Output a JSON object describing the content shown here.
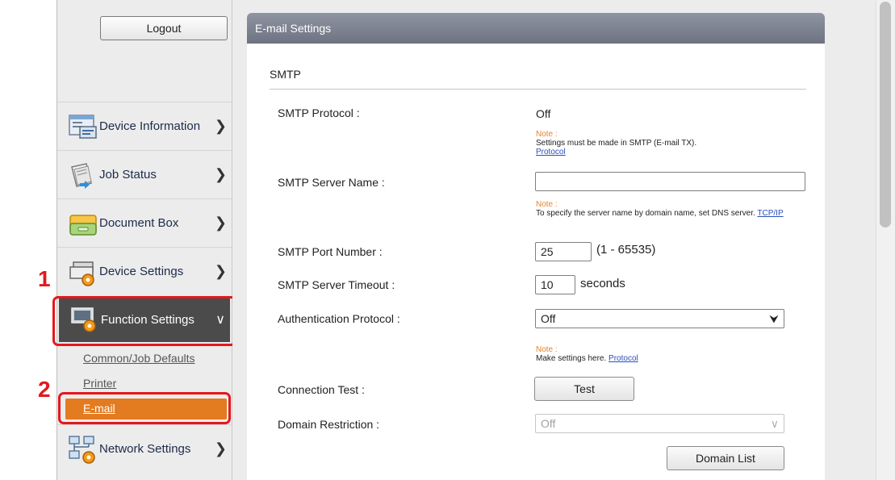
{
  "sidebar": {
    "logout_label": "Logout",
    "items": [
      {
        "label": "Device Information",
        "icon": "device-information-icon"
      },
      {
        "label": "Job Status",
        "icon": "job-status-icon"
      },
      {
        "label": "Document Box",
        "icon": "document-box-icon"
      },
      {
        "label": "Device Settings",
        "icon": "device-settings-icon"
      },
      {
        "label": "Function Settings",
        "icon": "function-settings-icon"
      },
      {
        "label": "Network Settings",
        "icon": "network-settings-icon"
      }
    ],
    "sub_items": [
      {
        "label": "Common/Job Defaults"
      },
      {
        "label": "Printer"
      },
      {
        "label": "E-mail"
      }
    ]
  },
  "callouts": {
    "step1": "1",
    "step2": "2"
  },
  "panel": {
    "title": "E-mail Settings",
    "section": "SMTP",
    "smtp_protocol": {
      "label": "SMTP Protocol :",
      "value": "Off"
    },
    "note1": {
      "heading": "Note :",
      "text": "Settings must be made in SMTP (E-mail TX).",
      "link": "Protocol"
    },
    "server_name": {
      "label": "SMTP Server Name :",
      "value": ""
    },
    "note2": {
      "heading": "Note :",
      "text": "To specify the server name by domain name, set DNS server.",
      "link": "TCP/IP"
    },
    "port": {
      "label": "SMTP Port Number :",
      "value": "25",
      "range": "(1 - 65535)"
    },
    "timeout": {
      "label": "SMTP Server Timeout :",
      "value": "10",
      "unit": "seconds"
    },
    "auth": {
      "label": "Authentication Protocol :",
      "value": "Off"
    },
    "note3": {
      "heading": "Note :",
      "text": "Make settings here.",
      "link": "Protocol"
    },
    "conn_test": {
      "label": "Connection Test :",
      "button": "Test"
    },
    "domain_restriction": {
      "label": "Domain Restriction :",
      "value": "Off"
    },
    "domain_list_button": "Domain List"
  },
  "colors": {
    "accent_orange": "#e37b21",
    "callout_red": "#e2191d",
    "header_gray": "#7c8290",
    "note_orange": "#e9832b",
    "link_blue": "#2a4fb8"
  }
}
